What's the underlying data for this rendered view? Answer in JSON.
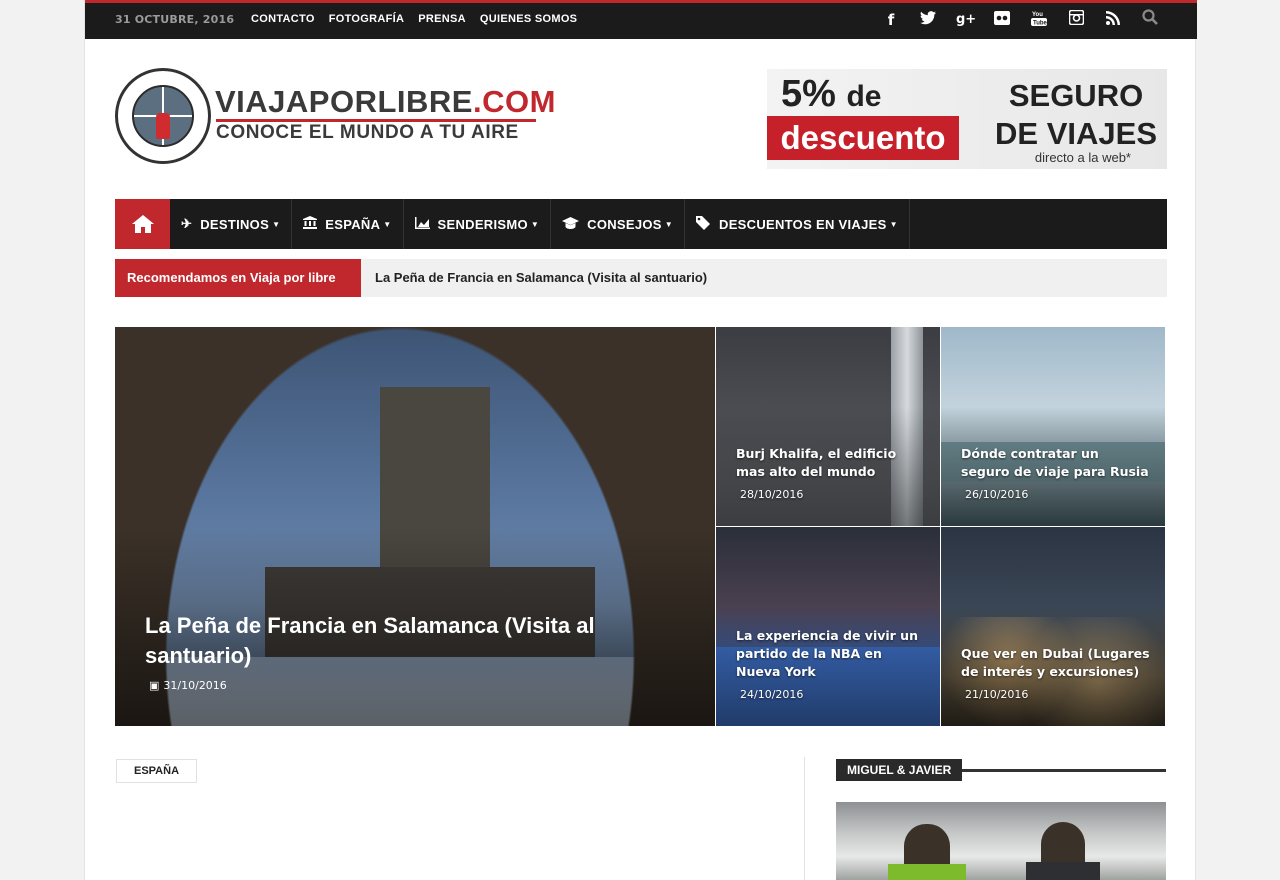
{
  "topbar": {
    "date": "31 OCTUBRE, 2016",
    "links": [
      "CONTACTO",
      "FOTOGRAFÍA",
      "PRENSA",
      "QUIENES SOMOS"
    ],
    "social_icons": [
      "facebook-icon",
      "twitter-icon",
      "google-plus-icon",
      "flickr-icon",
      "youtube-icon",
      "instagram-icon",
      "rss-icon",
      "search-icon"
    ]
  },
  "logo": {
    "title_main": "VIAJAPORLIBRE",
    "title_ext": ".COM",
    "subtitle": "CONOCE EL MUNDO A TU AIRE"
  },
  "ad": {
    "percent": "5%",
    "de": "de",
    "descuento": "descuento",
    "line1": "SEGURO",
    "line2": "DE VIAJES",
    "line3": "directo a la web*"
  },
  "nav": {
    "items": [
      {
        "label": "DESTINOS",
        "icon": "plane-icon"
      },
      {
        "label": "ESPAÑA",
        "icon": "bank-icon"
      },
      {
        "label": "SENDERISMO",
        "icon": "chart-area-icon"
      },
      {
        "label": "CONSEJOS",
        "icon": "graduation-cap-icon"
      },
      {
        "label": "DESCUENTOS EN VIAJES",
        "icon": "tags-icon"
      }
    ]
  },
  "ticker": {
    "label": "Recomendamos en Viaja por libre",
    "text": "La Peña de Francia en Salamanca (Visita al santuario)"
  },
  "featured": {
    "main": {
      "title": "La Peña de Francia en Salamanca (Visita al santuario)",
      "date": "31/10/2016"
    },
    "tiles": [
      {
        "title": "Burj Khalifa, el edificio mas alto del mundo",
        "date": "28/10/2016"
      },
      {
        "title": "Dónde contratar un seguro de viaje para Rusia",
        "date": "26/10/2016"
      },
      {
        "title": "La experiencia de vivir un partido de la NBA en Nueva York",
        "date": "24/10/2016"
      },
      {
        "title": "Que ver en Dubai (Lugares de interés y excursiones)",
        "date": "21/10/2016"
      }
    ]
  },
  "section": {
    "tag": "ESPAÑA"
  },
  "sidebar": {
    "widget_title": "MIGUEL & JAVIER"
  },
  "colors": {
    "accent": "#c0282e",
    "dark": "#1b1b1b"
  }
}
